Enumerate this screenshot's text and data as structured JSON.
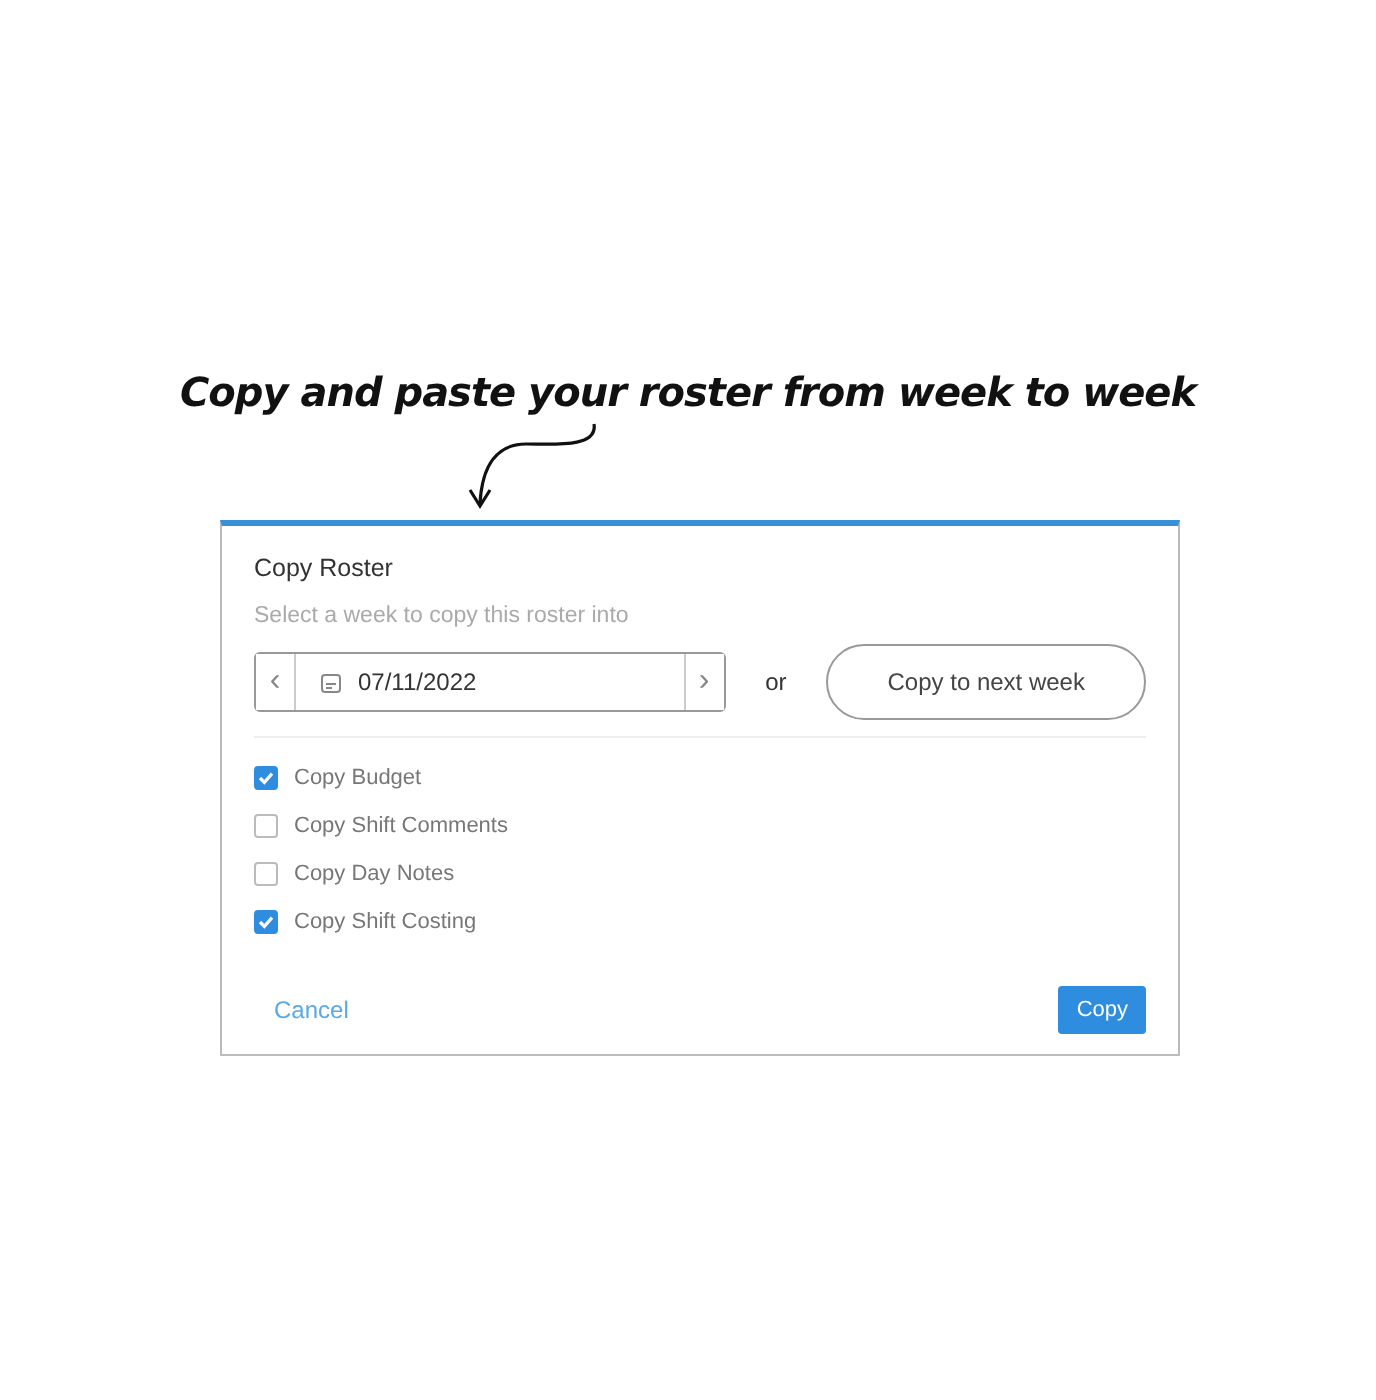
{
  "caption": "Copy and paste your roster from week to week",
  "dialog": {
    "title": "Copy Roster",
    "subtitle": "Select a week to copy this roster into",
    "week_picker": {
      "prev": "‹",
      "value": "07/11/2022",
      "next": "›"
    },
    "separator": "or",
    "next_week_button": "Copy to next week",
    "options": [
      {
        "label": "Copy Budget",
        "checked": true
      },
      {
        "label": "Copy Shift Comments",
        "checked": false
      },
      {
        "label": "Copy Day Notes",
        "checked": false
      },
      {
        "label": "Copy Shift Costing",
        "checked": true
      }
    ],
    "cancel": "Cancel",
    "copy": "Copy"
  }
}
